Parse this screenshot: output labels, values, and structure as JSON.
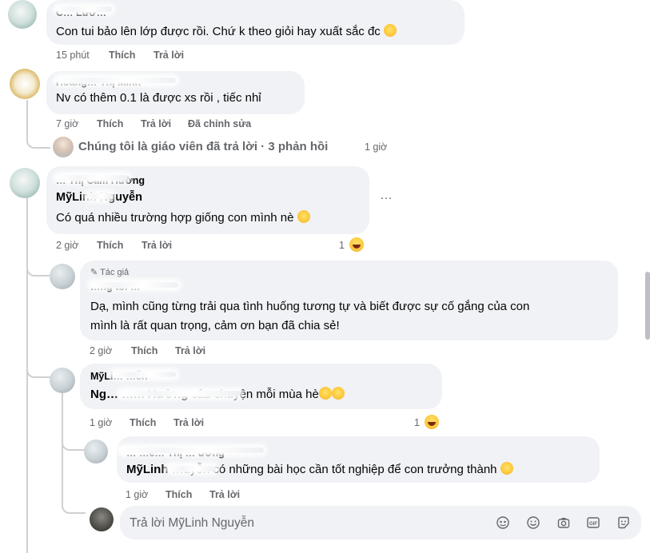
{
  "comments": {
    "c1": {
      "name": "C… Lươ…",
      "text": "Con tui bảo lên lớp được rồi. Chứ k theo giỏi hay xuất sắc đc",
      "time": "15 phút",
      "like": "Thích",
      "reply": "Trả lời"
    },
    "c2": {
      "name": "Hoàng… Thị Minh",
      "text": "Nv có thêm 0.1 là được xs rồi , tiếc nhỉ",
      "time": "7 giờ",
      "like": "Thích",
      "reply": "Trả lời",
      "edited": "Đã chỉnh sửa",
      "thread_summary": "Chúng tôi là giáo viên đã trả lời · 3 phản hồi",
      "thread_time": "1 giờ"
    },
    "c3": {
      "name": "… Thị Cẩm Hường",
      "mention": "MỹLinh Nguyễn",
      "text": "Có quá nhiều trường hợp giống con mình nè",
      "time": "2 giờ",
      "like": "Thích",
      "reply": "Trả lời",
      "reactions": "1",
      "more": "…"
    },
    "r1": {
      "author_badge": "Tác giả",
      "name": "…ng tôi …",
      "text_line1": "Dạ, mình cũng từng trải qua tình huống tương tự và biết được sự cố gắng của con",
      "text_line2": "mình là rất quan trọng, cảm ơn bạn đã chia sẻ!",
      "time": "2 giờ",
      "like": "Thích",
      "reply": "Trả lời"
    },
    "r2": {
      "name": "MỹLi… …ễn",
      "mention": "Ng… …m Hường",
      "text": " câu chuyện mỗi mùa hè",
      "time": "1 giờ",
      "like": "Thích",
      "reply": "Trả lời",
      "reactions": "1"
    },
    "r3": {
      "name": "… …ễ… Thị … ương",
      "mention": "MỹLinh",
      "text": " …uyễn có những bài học cần tốt nghiệp để con trưởng thành",
      "time": "1 giờ",
      "like": "Thích",
      "reply": "Trả lời"
    }
  },
  "reply_input": {
    "placeholder": "Trả lời MỹLinh Nguyễn",
    "tools": [
      "sticker-icon",
      "emoji-icon",
      "camera-icon",
      "gif-icon",
      "sticker-smile-icon"
    ]
  }
}
